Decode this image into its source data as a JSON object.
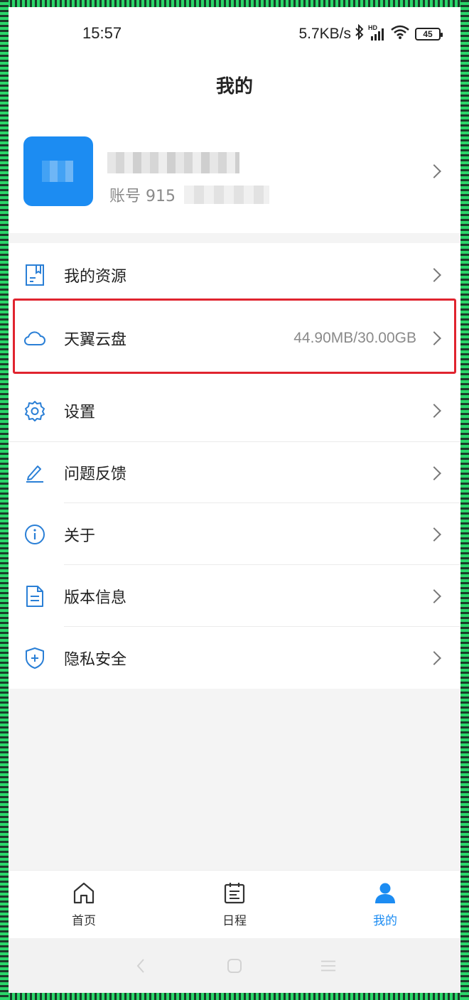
{
  "status_bar": {
    "time": "15:57",
    "network_speed": "5.7KB/s",
    "hd_label": "HD",
    "battery": "45"
  },
  "header": {
    "title": "我的"
  },
  "profile": {
    "account_prefix": "账号 915"
  },
  "menu": {
    "items": [
      {
        "label": "我的资源",
        "icon": "document-icon"
      },
      {
        "label": "天翼云盘",
        "icon": "cloud-icon",
        "value": "44.90MB/30.00GB"
      },
      {
        "label": "设置",
        "icon": "gear-icon"
      },
      {
        "label": "问题反馈",
        "icon": "pencil-icon"
      },
      {
        "label": "关于",
        "icon": "info-icon"
      },
      {
        "label": "版本信息",
        "icon": "file-icon"
      },
      {
        "label": "隐私安全",
        "icon": "shield-icon"
      }
    ]
  },
  "bottom_nav": {
    "items": [
      {
        "label": "首页",
        "icon": "home-icon"
      },
      {
        "label": "日程",
        "icon": "calendar-icon"
      },
      {
        "label": "我的",
        "icon": "person-icon",
        "active": true
      }
    ]
  },
  "colors": {
    "accent": "#1c8cf2",
    "highlight": "#e0242f"
  }
}
